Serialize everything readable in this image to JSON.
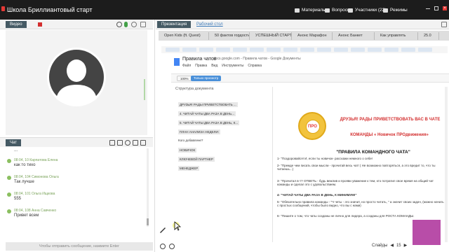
{
  "app": {
    "title": "Школа Бриллиантовый старт"
  },
  "topmenu": [
    {
      "label": "Материалы"
    },
    {
      "label": "Вопросы"
    },
    {
      "label": "Участники (22)"
    },
    {
      "label": "Режимы"
    }
  ],
  "left_panel": {
    "video_tab": "Видео",
    "chat_tab": "Чат"
  },
  "chat": {
    "messages": [
      {
        "meta": "",
        "text": "..."
      },
      {
        "meta": "08:04, 10 Карпатова Елена",
        "text": "как то тихо"
      },
      {
        "meta": "08:04, 104 Симонова Ольга",
        "text": "Так лучше"
      },
      {
        "meta": "08:04, 101 Ольга Ищкова",
        "text": "555"
      },
      {
        "meta": "08:04, 108 Анна Савченко",
        "text": "Привет всем"
      }
    ],
    "input_placeholder": "Чтобы отправить сообщение, нажмите Enter"
  },
  "right_panel": {
    "tab_presentation": "Презентация",
    "tab_desktop": "Рабочий стол"
  },
  "browser": {
    "tabs": [
      "Open Kids (ft. Quest)",
      "50 фактов гордости",
      "УСПЕШНЫЙ СТАРТ",
      "Анонс Марафон",
      "Анонс Банкет",
      "Как управлять",
      "25.0"
    ]
  },
  "docs": {
    "title": "Правила чатов",
    "url": "docs.google.com - Правила чатов - Google Документы",
    "menu": [
      "Файл",
      "Правка",
      "Вид",
      "Инструменты",
      "Справка"
    ],
    "toolbar_chips": [
      "100%",
      "Только просмотр"
    ],
    "outline_title": "Структура документа",
    "outline": [
      "ДРУЗЬЯ! РАДЫ ПРИВЕТСТВОВАТЬ ...",
      "4. ЧИТАЙ ЧАТЫ ДВА РАЗА В ДЕНЬ...",
      "5. ЧИТАЙ ЧАТЫ ДВА РАЗА В ДЕНЬ, К...",
      "ПЛАН АНАЛИЗА НЕДЕЛИ:",
      "Кого добавлене?",
      "НОВИЧОК",
      "КЛЮЧЕВОЙ ПАРТНЕР",
      "МЕНЕДЖЕР"
    ],
    "emblem_text": "ПРО",
    "headline1": "ДРУЗЬЯ! РАДЫ ПРИВЕТСТВОВАТЬ ВАС В ЧАТЕ",
    "headline2": "КОМАНДЫ « Новичок ПРОдвижения»",
    "section_title": "\"ПРАВИЛА КОМАНДНОГО ЧАТА\"",
    "lines": [
      "1- \"Поздоровайся! И, если ты новичок- расскажи немного о себе!",
      "2- \"Прежде чем писать свои мысли - прочитай весь чат! ( Не возможно повторяться, а это вредит то, что ты читаешь...)",
      "3- \"Прочитал в-т? ОТВЕТЬ - будь вежлив и прояви уважение к тем, кто потратил свое время на общий чат команды и сделал это с удовольствием.",
      "4- \"ЧИТАЙ ЧАТЫ ДВА РАЗА В ДЕНЬ, К МИНИМУМ!\"",
      "5- \"Обязательно правила команды - \"Ч четы - это значит, но просто читать, \" а значит своих задач, (можно начать с простых сообщений, чтобы было видно, что вы с нами)",
      "6- \"Пишите о том, что чаты созданы не лично для лидера, а созданы для РОСТА КОМАНДЫ."
    ]
  },
  "pager": {
    "label": "Слайды",
    "current": "15"
  },
  "colors": {
    "topbar": "#1c1c1c",
    "accent": "#455a64",
    "record": "#d32f2f",
    "chat_meta": "#7aa35a",
    "doc_red": "#d32f2f",
    "emblem": "#f2c33d"
  },
  "icons": {
    "record": "record-square-icon",
    "mic": "microphone-icon",
    "settings": "settings-icon",
    "zoom_in": "zoom-in-icon",
    "zoom_out": "zoom-out-icon",
    "pencil": "pencil-icon"
  }
}
